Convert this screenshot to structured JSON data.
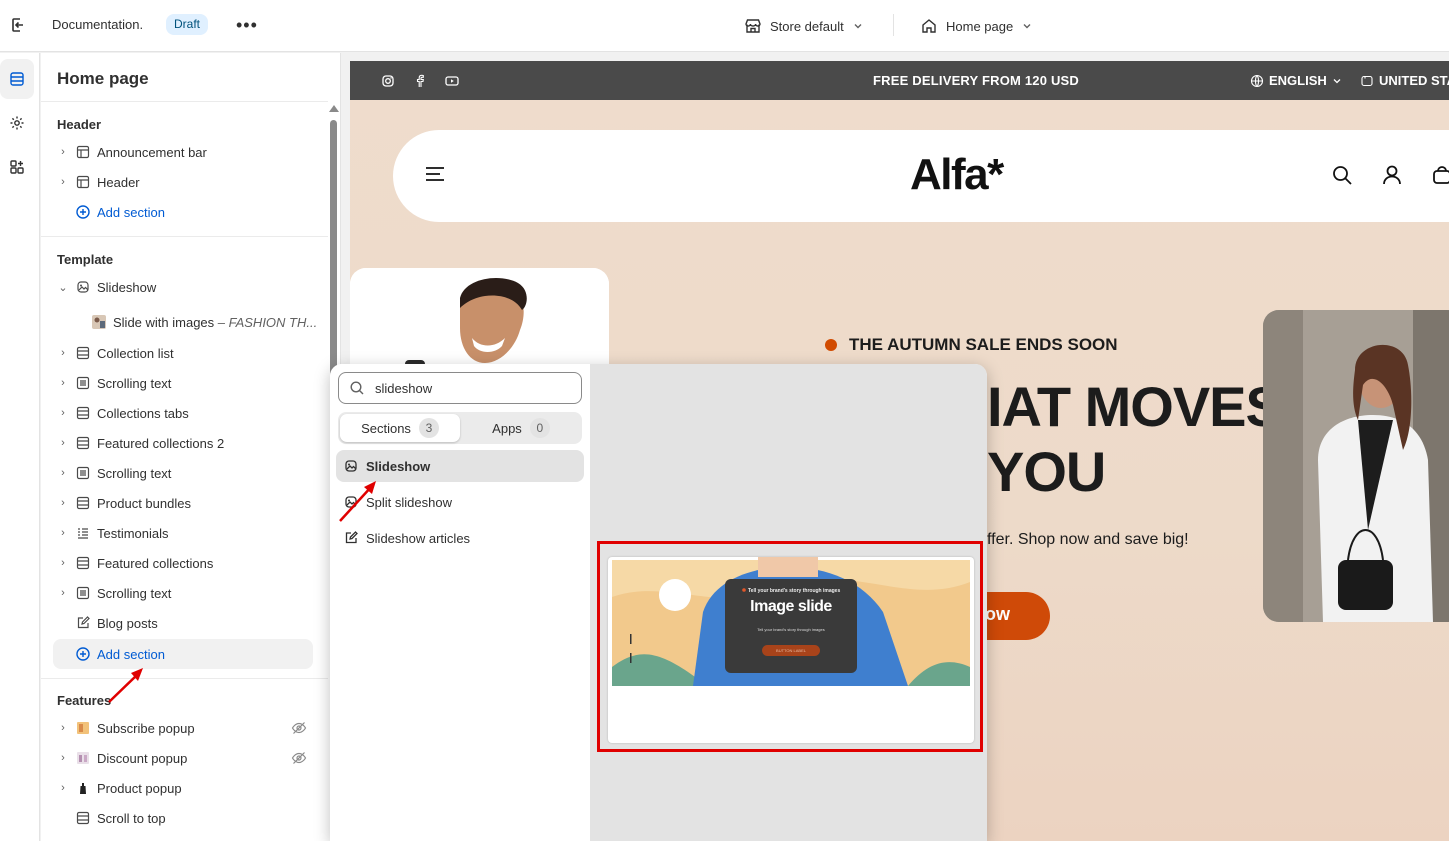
{
  "topbar": {
    "doc_name": "Documentation.",
    "status_badge": "Draft",
    "store_selector": "Store default",
    "page_selector": "Home page"
  },
  "sidebar": {
    "title": "Home page",
    "header_group": {
      "title": "Header",
      "items": [
        {
          "label": "Announcement bar"
        },
        {
          "label": "Header"
        }
      ],
      "add_label": "Add section"
    },
    "template_group": {
      "title": "Template",
      "slideshow": {
        "label": "Slideshow"
      },
      "slide_child": {
        "label": "Slide with images",
        "suffix": " – FASHION TH..."
      },
      "items": [
        {
          "label": "Collection list"
        },
        {
          "label": "Scrolling text"
        },
        {
          "label": "Collections tabs"
        },
        {
          "label": "Featured collections 2"
        },
        {
          "label": "Scrolling text"
        },
        {
          "label": "Product bundles"
        },
        {
          "label": "Testimonials"
        },
        {
          "label": "Featured collections"
        },
        {
          "label": "Scrolling text"
        },
        {
          "label": "Blog posts"
        }
      ],
      "add_label": "Add section"
    },
    "features_group": {
      "title": "Features",
      "items": [
        {
          "label": "Subscribe popup"
        },
        {
          "label": "Discount popup"
        },
        {
          "label": "Product popup"
        },
        {
          "label": "Scroll to top"
        }
      ]
    }
  },
  "preview": {
    "announcement": "FREE DELIVERY FROM 120 USD",
    "language": "ENGLISH",
    "country": "UNITED STA",
    "logo": "Alfa*",
    "sale_label": "THE AUTUMN SALE ENDS SOON",
    "headline_1": "IAT MOVES",
    "headline_2": "YOU",
    "offer_text": "ffer. Shop now and save big!",
    "cta_label": "ow"
  },
  "popover": {
    "search_value": "slideshow",
    "tabs": [
      {
        "label": "Sections",
        "count": "3"
      },
      {
        "label": "Apps",
        "count": "0"
      }
    ],
    "results": [
      {
        "label": "Slideshow"
      },
      {
        "label": "Split slideshow"
      },
      {
        "label": "Slideshow articles"
      }
    ],
    "preview_image": {
      "kicker": "Tell your brand's story through images",
      "title": "Image slide",
      "sub": "Tell your brand's story through images",
      "button": "BUTTON LABEL"
    }
  },
  "colors": {
    "accent_blue": "#005bd3",
    "cta_orange": "#cf4a08",
    "highlight_red": "#e00000",
    "announcement_bg": "#4a4a4a"
  }
}
